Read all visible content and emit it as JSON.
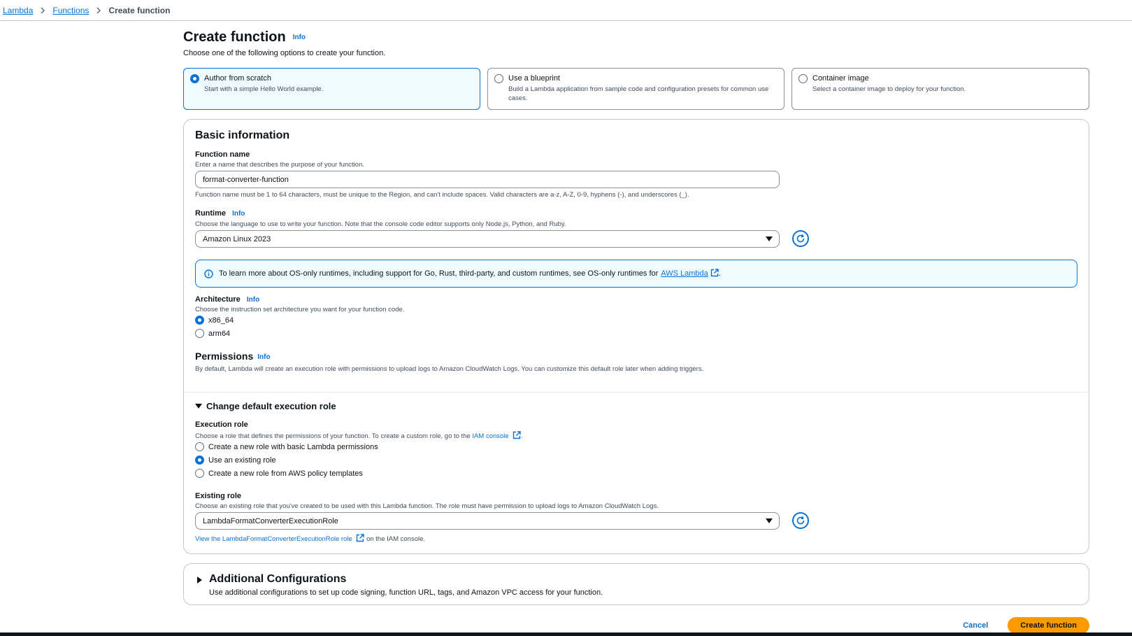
{
  "breadcrumb": {
    "items": [
      "Lambda",
      "Functions"
    ],
    "current": "Create function"
  },
  "page": {
    "title": "Create function",
    "info": "Info",
    "subtitle": "Choose one of the following options to create your function."
  },
  "options": [
    {
      "title": "Author from scratch",
      "desc": "Start with a simple Hello World example.",
      "selected": true
    },
    {
      "title": "Use a blueprint",
      "desc": "Build a Lambda application from sample code and configuration presets for common use cases.",
      "selected": false
    },
    {
      "title": "Container image",
      "desc": "Select a container image to deploy for your function.",
      "selected": false
    }
  ],
  "basic": {
    "title": "Basic information",
    "function_name": {
      "label": "Function name",
      "desc": "Enter a name that describes the purpose of your function.",
      "value": "format-converter-function",
      "constraint": "Function name must be 1 to 64 characters, must be unique to the Region, and can't include spaces. Valid characters are a-z, A-Z, 0-9, hyphens (-), and underscores (_)."
    },
    "runtime": {
      "label": "Runtime",
      "info": "Info",
      "desc": "Choose the language to use to write your function. Note that the console code editor supports only Node.js, Python, and Ruby.",
      "value": "Amazon Linux 2023"
    },
    "alert": {
      "text": "To learn more about OS-only runtimes, including support for Go, Rust, third-party, and custom runtimes, see OS-only runtimes for",
      "link": "AWS Lambda",
      "suffix": "."
    },
    "architecture": {
      "label": "Architecture",
      "info": "Info",
      "desc": "Choose the instruction set architecture you want for your function code.",
      "options": [
        "x86_64",
        "arm64"
      ],
      "selected": "x86_64"
    },
    "permissions": {
      "title": "Permissions",
      "info": "Info",
      "desc": "By default, Lambda will create an execution role with permissions to upload logs to Amazon CloudWatch Logs. You can customize this default role later when adding triggers."
    },
    "change_role": {
      "title": "Change default execution role",
      "execution_role": {
        "label": "Execution role",
        "desc": "Choose a role that defines the permissions of your function. To create a custom role, go to the",
        "desc_link": "IAM console",
        "desc_suffix": ".",
        "options": [
          "Create a new role with basic Lambda permissions",
          "Use an existing role",
          "Create a new role from AWS policy templates"
        ],
        "selected": "Use an existing role"
      },
      "existing_role": {
        "label": "Existing role",
        "desc": "Choose an existing role that you've created to be used with this Lambda function. The role must have permission to upload logs to Amazon CloudWatch Logs.",
        "value": "LambdaFormatConverterExecutionRole",
        "view_link": "View the LambdaFormatConverterExecutionRole role",
        "view_suffix": "on the IAM console."
      }
    }
  },
  "additional": {
    "title": "Additional Configurations",
    "desc": "Use additional configurations to set up code signing, function URL, tags, and Amazon VPC access for your function."
  },
  "actions": {
    "cancel": "Cancel",
    "create": "Create function"
  },
  "colors": {
    "accent": "#0972d3",
    "primary_button": "#ff9900",
    "selected_tile_bg": "#f0fbff"
  }
}
